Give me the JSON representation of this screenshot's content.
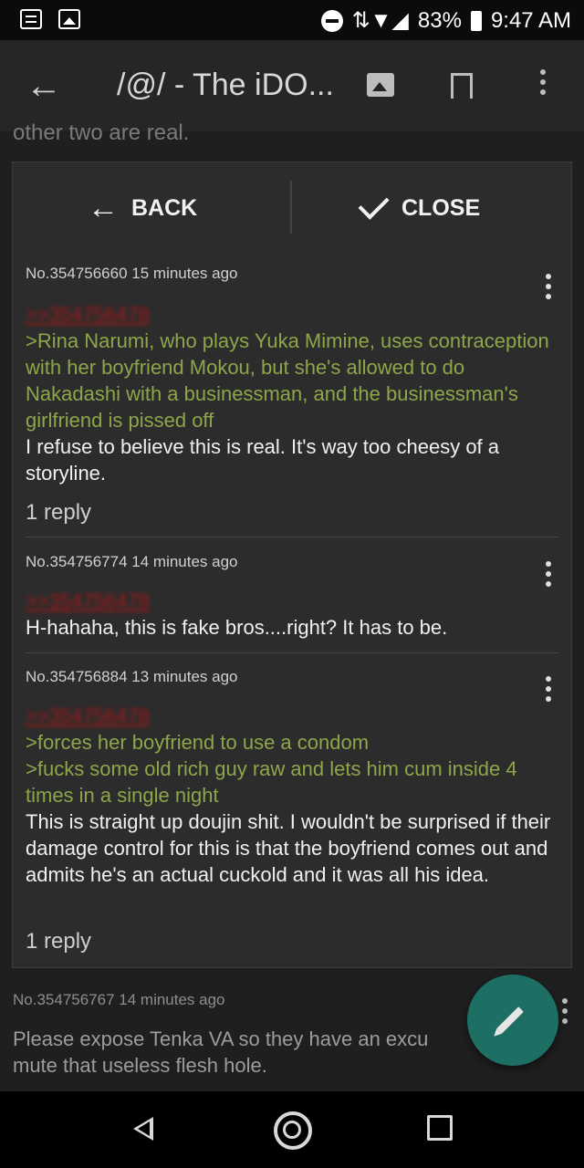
{
  "status_bar": {
    "battery": "83%",
    "time": "9:47 AM"
  },
  "toolbar": {
    "title": "/@/ - The iDO..."
  },
  "background_snippet": "other two are real.",
  "dialog": {
    "back_label": "BACK",
    "close_label": "CLOSE",
    "posts": [
      {
        "meta": "No.354756660 15 minutes ago",
        "quote_ref": ">>354756478",
        "greentext": ">Rina Narumi, who plays Yuka Mimine, uses contraception with her boyfriend Mokou, but she's allowed to do Nakadashi with a businessman, and the businessman's girlfriend is pissed off",
        "text": "I refuse to believe this is real. It's way too cheesy of a storyline.",
        "replies": "1 reply"
      },
      {
        "meta": "No.354756774 14 minutes ago",
        "quote_ref": ">>354756478",
        "text": "H-hahaha, this is fake bros....right? It has to be."
      },
      {
        "meta": "No.354756884 13 minutes ago",
        "quote_ref": ">>354756478",
        "greentext_1": ">forces her boyfriend to use a condom",
        "greentext_2": ">fucks some old rich guy raw and lets him cum inside 4 times in a single night",
        "text": "This is straight up doujin shit. I wouldn't be surprised if their damage control for this is that the boyfriend comes out and admits he's an actual cuckold and it was all his idea.",
        "replies": "1 reply"
      }
    ]
  },
  "background_post": {
    "meta": "No.354756767 14 minutes ago",
    "text": "Please expose Tenka VA so they have an excu mute that useless flesh hole."
  },
  "icons": {
    "back": "arrow-left-icon",
    "image": "image-icon",
    "bookmark": "bookmark-icon",
    "more": "more-vert-icon",
    "fab": "pencil-icon",
    "nav_back": "nav-back-icon",
    "nav_home": "nav-home-icon",
    "nav_recent": "nav-recent-icon"
  },
  "colors": {
    "greentext": "#8ea64a",
    "quote_ref": "#a11818",
    "fab": "#1d6e63"
  }
}
